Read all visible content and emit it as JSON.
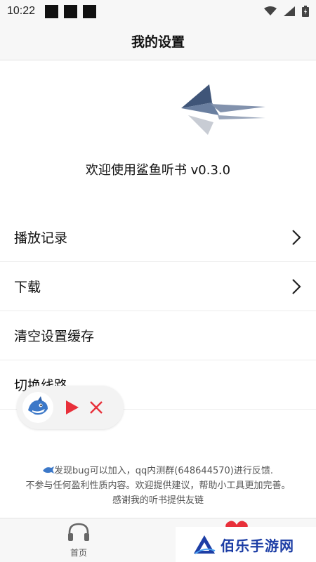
{
  "status_bar": {
    "time": "10:22"
  },
  "header": {
    "title": "我的设置"
  },
  "hero": {
    "welcome_text": "欢迎使用鲨鱼听书 v0.3.0"
  },
  "menu": {
    "items": [
      {
        "label": "播放记录",
        "has_chevron": true
      },
      {
        "label": "下载",
        "has_chevron": true
      },
      {
        "label": "清空设置缓存",
        "has_chevron": false
      },
      {
        "label": "切换线路",
        "has_chevron": false
      }
    ]
  },
  "footer": {
    "line1": "发现bug可以加入，qq内测群(648644570)进行反馈.",
    "line2": "不参与任何盈利性质内容。欢迎提供建议，帮助小工具更加完善。",
    "line3": "感谢我的听书提供友链"
  },
  "tabbar": {
    "home_label": "首页"
  },
  "watermark": {
    "text": "佰乐手游网"
  },
  "colors": {
    "play": "#e8303a",
    "close": "#e8303a",
    "logo": "#5a6f8e",
    "watermark": "#1d3ea5"
  },
  "icons": [
    "wifi-icon",
    "signal-icon",
    "battery-icon",
    "shark-logo",
    "chevron-right-icon",
    "play-icon",
    "close-icon",
    "headphones-icon",
    "heart-icon"
  ]
}
